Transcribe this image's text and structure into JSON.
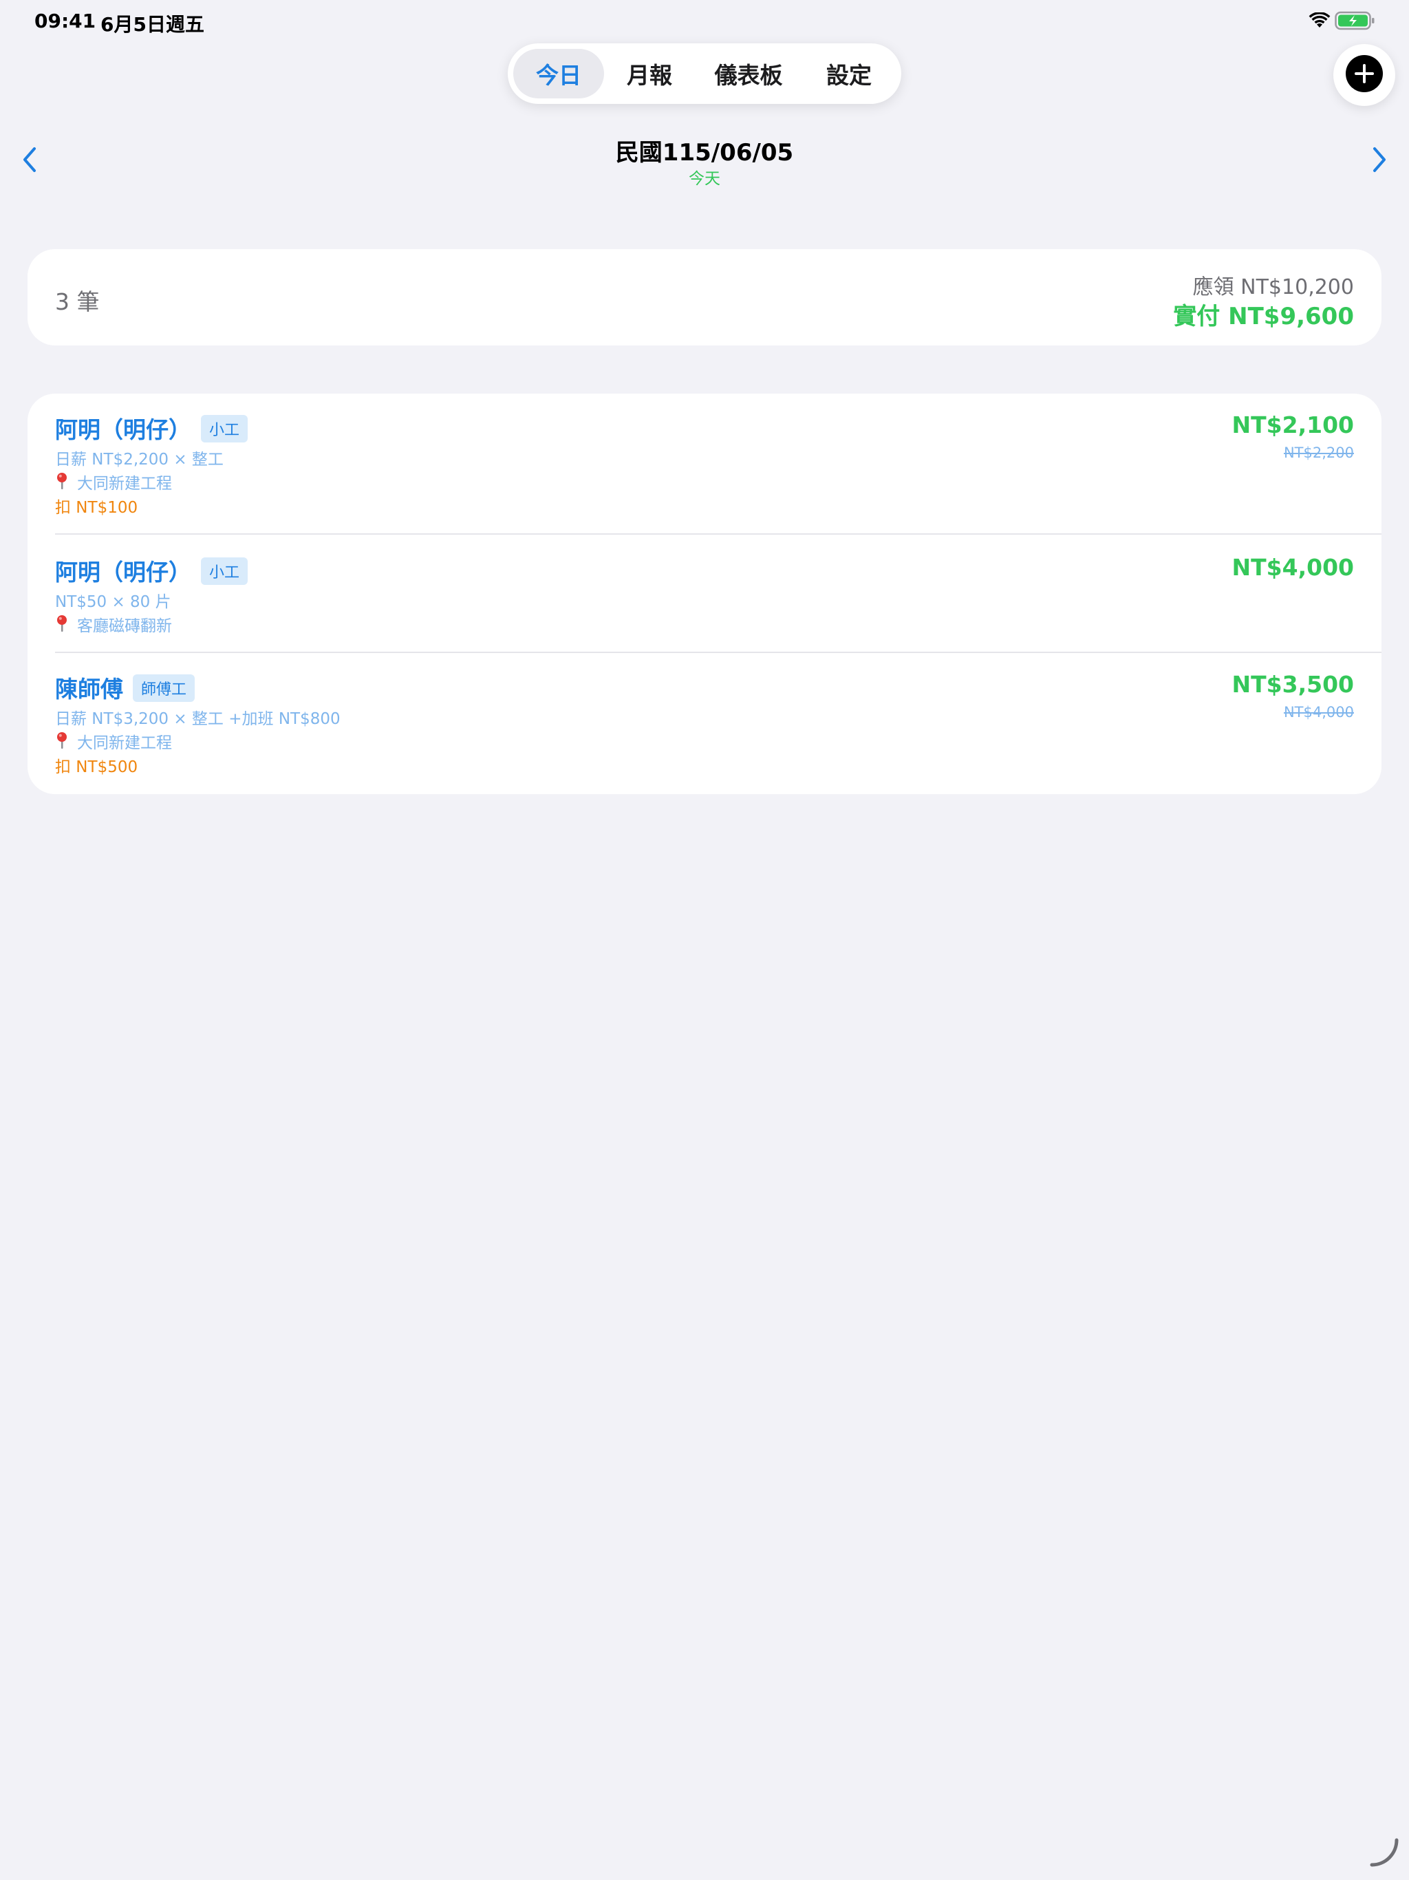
{
  "status_bar": {
    "time": "09:41",
    "date": "6月5日週五",
    "wifi_icon": "wifi-icon",
    "battery_icon": "battery-charging-icon",
    "battery_color": "#34C759"
  },
  "tabs": [
    {
      "label": "今日",
      "active": true
    },
    {
      "label": "月報",
      "active": false
    },
    {
      "label": "儀表板",
      "active": false
    },
    {
      "label": "設定",
      "active": false
    }
  ],
  "add_button_icon": "plus-circle-icon",
  "date_header": {
    "title": "民國115/06/05",
    "subtitle": "今天",
    "prev_icon": "chevron-left-icon",
    "next_icon": "chevron-right-icon"
  },
  "summary": {
    "count": "3 筆",
    "due": "應領 NT$10,200",
    "paid": "實付 NT$9,600"
  },
  "records": [
    {
      "name": "阿明（明仔）",
      "badge": "小工",
      "line1": "日薪 NT$2,200 × 整工",
      "location": "大同新建工程",
      "deduction": "扣 NT$100",
      "amount": "NT$2,100",
      "original": "NT$2,200"
    },
    {
      "name": "阿明（明仔）",
      "badge": "小工",
      "line1": "NT$50 × 80 片",
      "location": "客廳磁磚翻新",
      "deduction": "",
      "amount": "NT$4,000",
      "original": ""
    },
    {
      "name": "陳師傅",
      "badge": "師傅工",
      "line1": "日薪 NT$3,200 × 整工 +加班 NT$800",
      "location": "大同新建工程",
      "deduction": "扣 NT$500",
      "amount": "NT$3,500",
      "original": "NT$4,000"
    }
  ],
  "colors": {
    "accent": "#1E7FE0",
    "positive": "#34C759",
    "deduction": "#F0860F",
    "background": "#F2F2F7"
  }
}
